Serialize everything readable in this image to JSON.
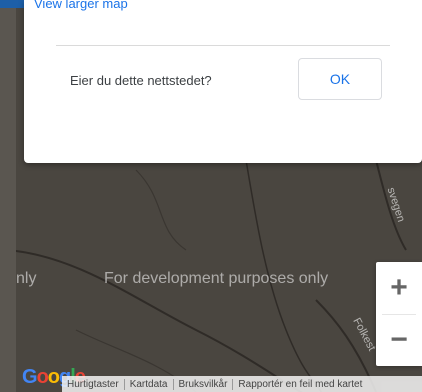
{
  "dialog": {
    "link_label": "View larger map",
    "question": "Eier du dette nettstedet?",
    "ok_label": "OK"
  },
  "map": {
    "dev_watermark_left": "nly",
    "dev_watermark": "For development purposes only",
    "road_label_a": "svegen",
    "road_label_b": "Folkest",
    "zoom_in_label": "+",
    "zoom_out_label": "−"
  },
  "footer": {
    "logo_text": "Google",
    "items": [
      "Hurtigtaster",
      "Kartdata",
      "Bruksvilkår",
      "Rapportér en feil med kartet"
    ]
  },
  "colors": {
    "accent": "#1a73e8",
    "map_background": "#4a4640",
    "top_bar": "#1d5fa8"
  }
}
